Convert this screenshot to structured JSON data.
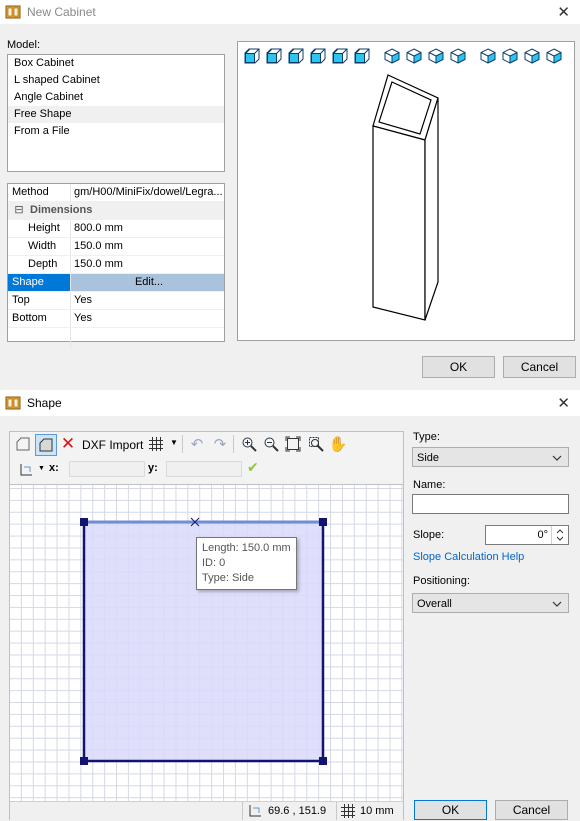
{
  "cabinet_window": {
    "title": "New Cabinet",
    "model_label": "Model:",
    "models": [
      {
        "label": "Box Cabinet",
        "selected": false
      },
      {
        "label": "L shaped Cabinet",
        "selected": false
      },
      {
        "label": "Angle Cabinet",
        "selected": false
      },
      {
        "label": "Free Shape",
        "selected": true
      },
      {
        "label": "From a File",
        "selected": false
      }
    ],
    "properties": {
      "method_key": "Method",
      "method_value": "gm/H00/MiniFix/dowel/Legra...",
      "group_label": "Dimensions",
      "group_toggle": "⊟",
      "height_key": "Height",
      "height_value": "800.0 mm",
      "width_key": "Width",
      "width_value": "150.0 mm",
      "depth_key": "Depth",
      "depth_value": "150.0 mm",
      "shape_key": "Shape",
      "shape_value": "Edit...",
      "top_key": "Top",
      "top_value": "Yes",
      "bottom_key": "Bottom",
      "bottom_value": "Yes"
    },
    "view_buttons": [
      "front-view-icon",
      "back-view-icon",
      "left-view-icon",
      "right-view-icon",
      "top-view-icon",
      "bottom-view-icon",
      "iso-view-1-icon",
      "iso-view-2-icon",
      "iso-view-3-icon",
      "iso-view-4-icon",
      "iso-view-5-icon",
      "iso-view-6-icon",
      "iso-view-7-icon",
      "iso-view-8-icon"
    ],
    "ok_label": "OK",
    "cancel_label": "Cancel"
  },
  "shape_window": {
    "title": "Shape",
    "toolbar": {
      "dxf_import_label": "DXF Import",
      "x_label": "x:",
      "y_label": "y:",
      "x_value": "",
      "y_value": ""
    },
    "tooltip": {
      "length": "Length: 150.0 mm",
      "id": "ID: 0",
      "type": "Type: Side"
    },
    "status": {
      "coords": "69.6 , 151.9",
      "grid_size": "10 mm"
    },
    "type_label": "Type:",
    "type_value": "Side",
    "name_label": "Name:",
    "name_value": "",
    "slope_label": "Slope:",
    "slope_value": "0°",
    "slope_help_link": "Slope Calculation Help",
    "positioning_label": "Positioning:",
    "positioning_value": "Overall",
    "ok_label": "OK",
    "cancel_label": "Cancel",
    "colors": {
      "shape_fill": "#d9d9fb",
      "shape_edge": "#141470",
      "selected_edge": "#6b8fd8",
      "grid": "#d5d8e6",
      "accent": "#0078d7"
    }
  }
}
